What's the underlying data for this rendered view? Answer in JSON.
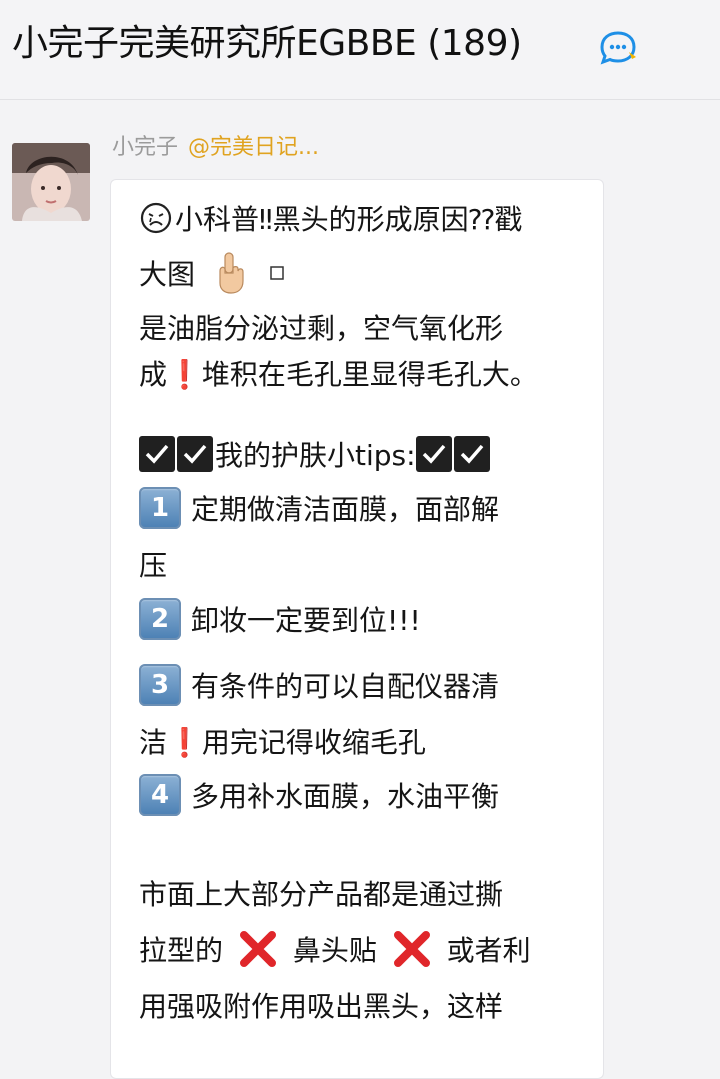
{
  "chat": {
    "title": "小完子完美研究所EGBBE (189)",
    "icon": "chat-bubble-icon"
  },
  "message": {
    "sender_name": "小完子",
    "mention": "@完美日记...",
    "avatar": "avatar-icon",
    "lines": [
      "小科普‼黑头的形成原因⁇戳",
      "大图",
      "是油脂分泌过剩，空气氧化形",
      "成❗堆积在毛孔里显得毛孔大。",
      "我的护肤小tips:",
      "定期做清洁面膜，面部解",
      "压",
      "卸妆一定要到位!!!",
      "有条件的可以自配仪器清",
      "洁❗用完记得收缩毛孔",
      "多用补水面膜，水油平衡",
      "市面上大部分产品都是通过撕",
      "拉型的",
      "鼻头贴",
      "或者利",
      "用强吸附作用吸出黑头，这样"
    ],
    "tip_numbers": [
      "1",
      "2",
      "3",
      "4"
    ],
    "emoji_names": [
      "crying-face-icon",
      "pointing-up-hand-icon",
      "check-box-icon",
      "cross-mark-icon",
      "keycap-number-icon"
    ]
  },
  "colors": {
    "background": "#f3f3f5",
    "bubble": "#ffffff",
    "sender_name": "#9b9b9b",
    "mention": "#e0a320",
    "chat_icon": "#1e8fe6",
    "cross": "#e0262a"
  }
}
